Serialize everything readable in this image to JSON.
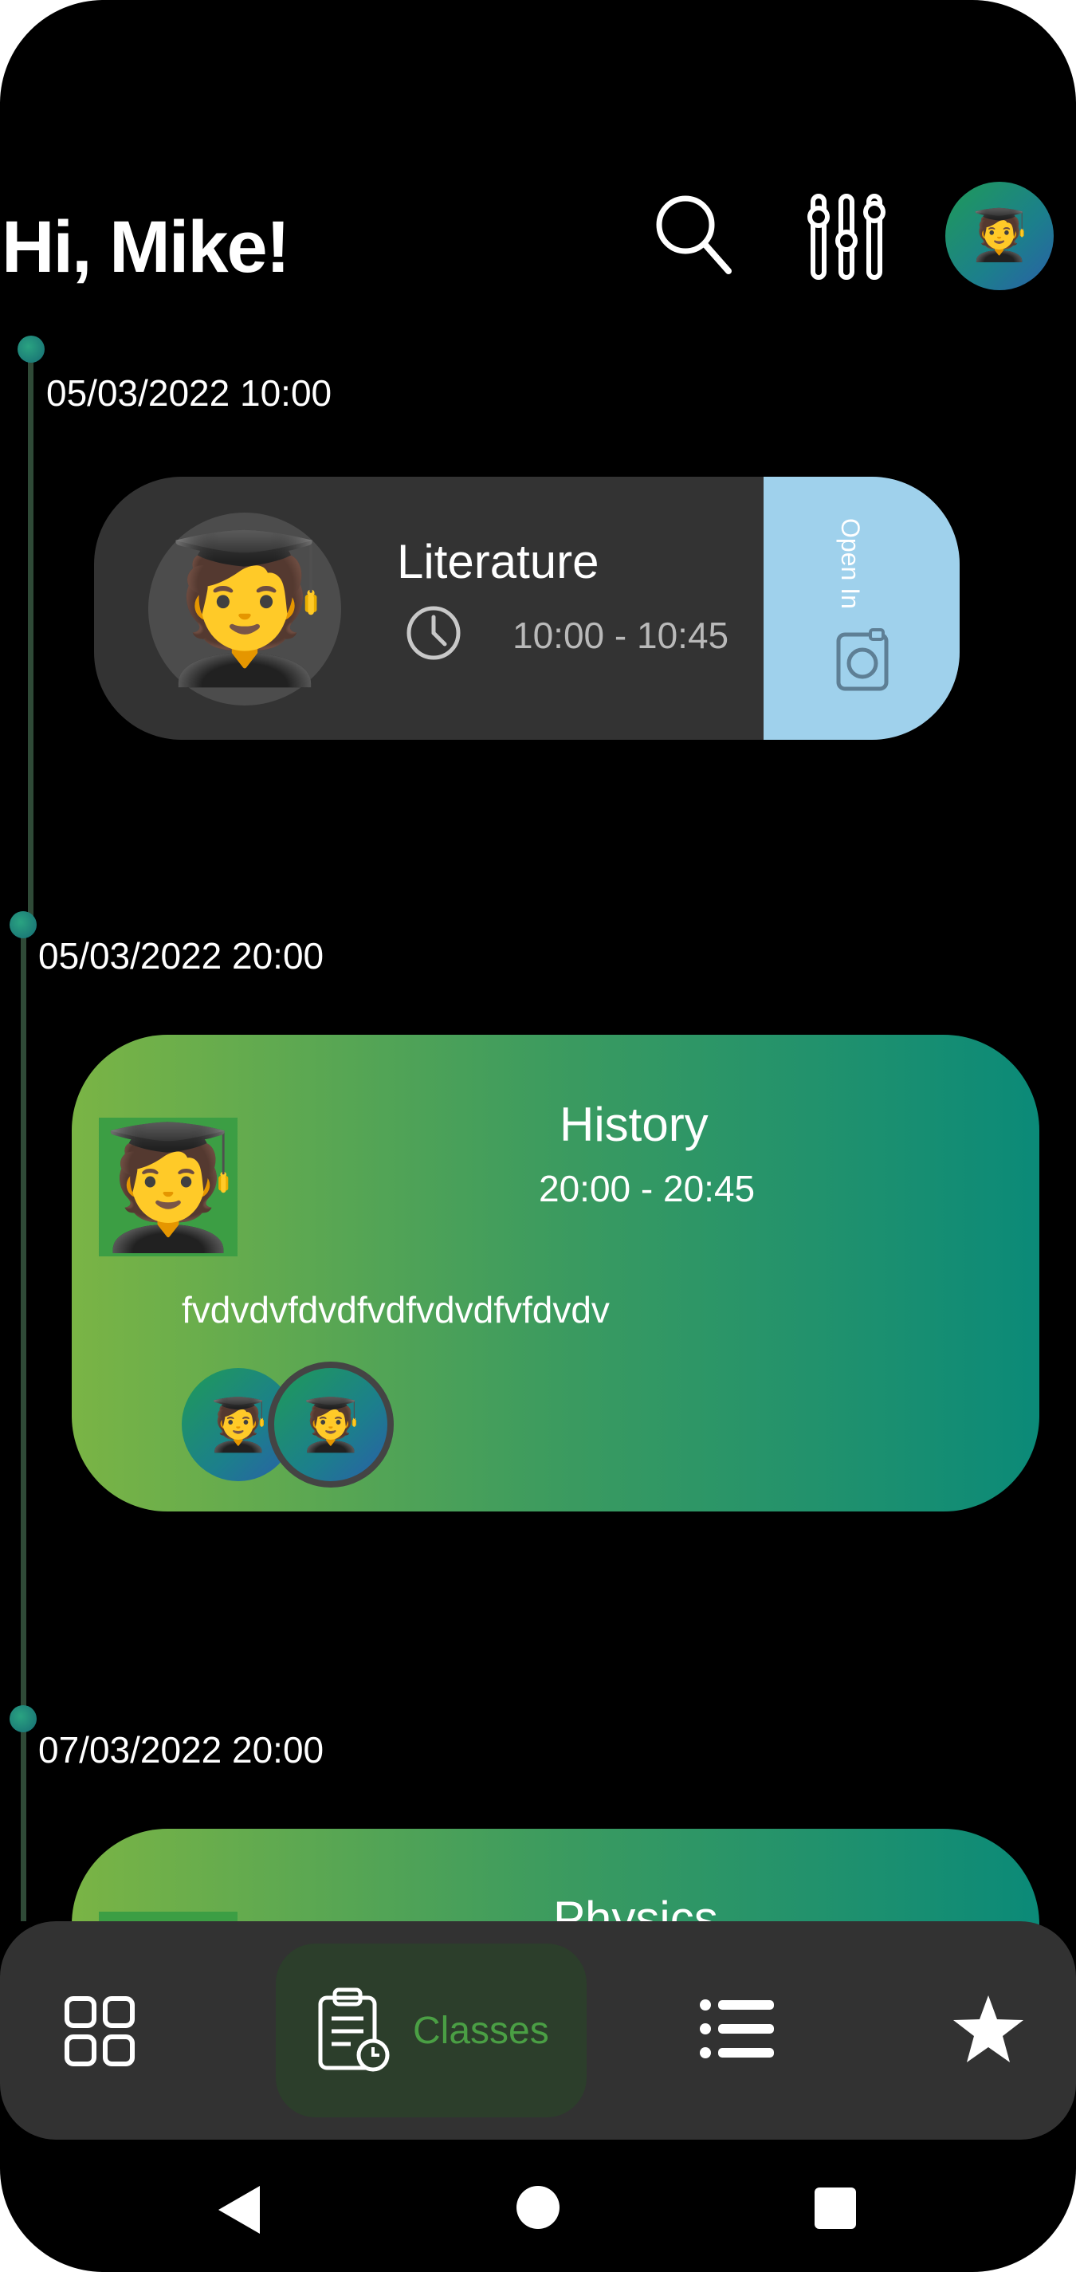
{
  "header": {
    "greeting": "Hi, Mike!",
    "search_icon": "search-icon",
    "filter_icon": "sliders-icon",
    "avatar_icon": "student-avatar-icon"
  },
  "timeline": [
    {
      "date": "05/03/2022 10:00",
      "card": {
        "style": "dark",
        "title": "Literature",
        "time": "10:00 - 10:45",
        "action_label": "Open In",
        "action_icon": "camera-icon",
        "action_color": "#9fd1ec"
      }
    },
    {
      "date": "05/03/2022 20:00",
      "card": {
        "style": "gradient",
        "title": "History",
        "time": "20:00 - 20:45",
        "description": "fvdvdvfdvdfvdfvdvdfvfdvdv",
        "participants": [
          "student-avatar-icon",
          "student-avatar-icon"
        ]
      }
    },
    {
      "date": "07/03/2022 20:00",
      "card": {
        "style": "gradient",
        "title": "Physics"
      }
    }
  ],
  "bottom_nav": {
    "items": [
      {
        "icon": "grid-icon",
        "label": ""
      },
      {
        "icon": "clipboard-clock-icon",
        "label": "Classes",
        "active": true
      },
      {
        "icon": "list-icon",
        "label": ""
      },
      {
        "icon": "star-icon",
        "label": ""
      }
    ],
    "active_color": "#4a9f44"
  },
  "system_nav": [
    "back-icon",
    "home-icon",
    "recents-icon"
  ],
  "colors": {
    "background": "#000000",
    "card_dark": "#333333",
    "gradient_start": "#7ab445",
    "gradient_end": "#0b8a78",
    "timeline_line": "#2f4a37"
  }
}
